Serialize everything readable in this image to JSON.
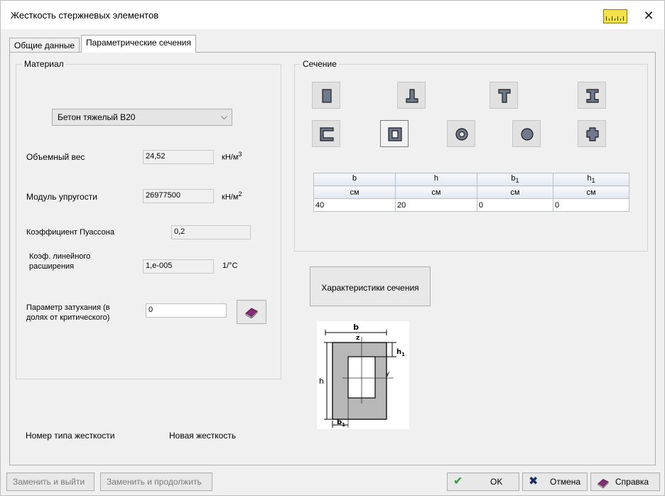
{
  "window": {
    "title": "Жесткость стержневых элементов",
    "close_glyph": "✕",
    "ruler_icon": "ruler-icon"
  },
  "tabs": [
    {
      "label": "Общие данные"
    },
    {
      "label": "Параметрические сечения"
    }
  ],
  "material": {
    "group_label": "Материал",
    "selected": "Бетон тяжелый B20",
    "volume_weight": {
      "label": "Объемный вес",
      "value": "24,52",
      "unit": "кН/м",
      "unit_sup": "3"
    },
    "elastic_modulus": {
      "label": "Модуль упругости",
      "value": "26977500",
      "unit": "кН/м",
      "unit_sup": "2"
    },
    "poisson": {
      "label": "Коэффициент Пуассона",
      "value": "0,2"
    },
    "expansion": {
      "label_line1": "Коэф. линейного",
      "label_line2": "расширения",
      "value": "1,e-005",
      "unit": "1/°C"
    },
    "damping": {
      "label_line1": "Параметр затухания (в",
      "label_line2": "долях от критического)",
      "value": "0"
    }
  },
  "section": {
    "group_label": "Сечение",
    "shapes": [
      "rectangle",
      "inverted-t",
      "t-section",
      "i-beam",
      "channel",
      "box",
      "ring",
      "circle",
      "cross"
    ],
    "selected": "box",
    "table": {
      "headers": [
        {
          "name": "b",
          "sub": ""
        },
        {
          "name": "h",
          "sub": ""
        },
        {
          "name": "b",
          "sub": "1"
        },
        {
          "name": "h",
          "sub": "1"
        }
      ],
      "units": [
        "см",
        "см",
        "см",
        "см"
      ],
      "values": [
        "40",
        "20",
        "0",
        "0"
      ]
    },
    "characteristics_button": "Характеристики сечения",
    "diagram": {
      "b": "b",
      "h": "h",
      "h1": "h",
      "h1_sub": "1",
      "b1": "b",
      "b1_sub": "1",
      "z": "z",
      "y": "y"
    }
  },
  "stiffness": {
    "label": "Номер типа жесткости",
    "value": "Новая жесткость"
  },
  "buttons": {
    "replace_exit": "Заменить и выйти",
    "replace_continue": "Заменить и продолжить",
    "ok": "OK",
    "cancel": "Отмена",
    "help": "Справка"
  },
  "colors": {
    "ok_green": "#2e9a2e",
    "cancel_blue": "#1b2a66",
    "ruler_yellow": "#f4e24a"
  }
}
